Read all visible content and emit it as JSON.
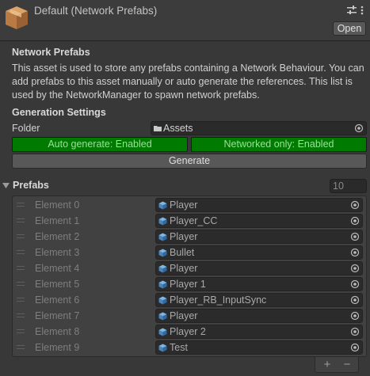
{
  "header": {
    "title": "Default (Network Prefabs)",
    "open_label": "Open",
    "icons": [
      "prefab-box-icon",
      "settings-sliders-icon",
      "more-vertical-icon"
    ]
  },
  "network_prefabs": {
    "heading": "Network Prefabs",
    "description": "This asset is used to store any prefabs containing a Network Behaviour. You can add prefabs to this asset manually or auto generate the references. This list is used by the NetworkManager to spawn network prefabs."
  },
  "generation_settings": {
    "heading": "Generation Settings",
    "folder_label": "Folder",
    "folder_value": "Assets",
    "auto_generate_label": "Auto generate: Enabled",
    "networked_only_label": "Networked only: Enabled",
    "generate_label": "Generate",
    "toggle_color": "#007a00"
  },
  "prefabs": {
    "heading": "Prefabs",
    "count": "10",
    "elements": [
      {
        "label": "Element 0",
        "value": "Player"
      },
      {
        "label": "Element 1",
        "value": "Player_CC"
      },
      {
        "label": "Element 2",
        "value": "Player"
      },
      {
        "label": "Element 3",
        "value": "Bullet"
      },
      {
        "label": "Element 4",
        "value": "Player"
      },
      {
        "label": "Element 5",
        "value": "Player 1"
      },
      {
        "label": "Element 6",
        "value": "Player_RB_InputSync"
      },
      {
        "label": "Element 7",
        "value": "Player"
      },
      {
        "label": "Element 8",
        "value": "Player 2"
      },
      {
        "label": "Element 9",
        "value": "Test"
      }
    ],
    "add_label": "+",
    "remove_label": "−"
  }
}
